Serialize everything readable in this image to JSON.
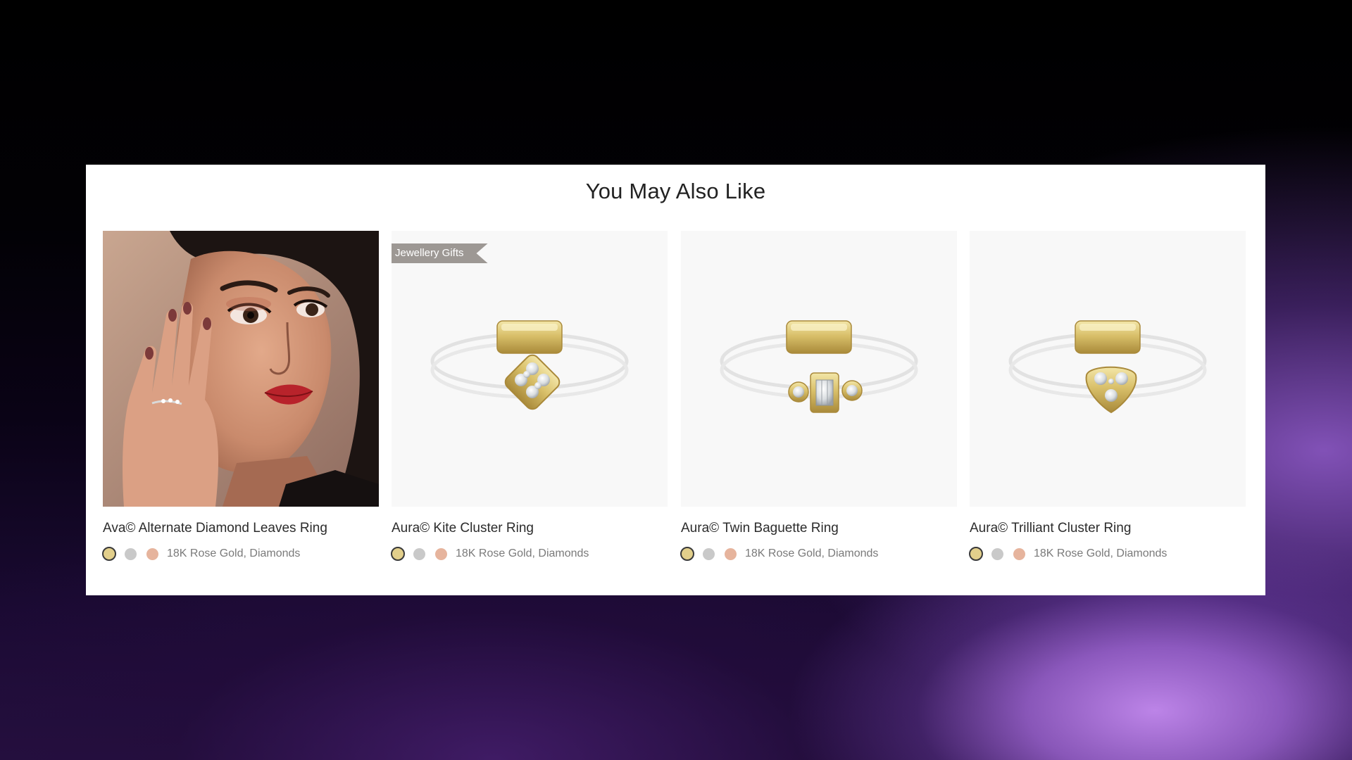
{
  "section": {
    "title": "You May Also Like"
  },
  "swatch_colors": {
    "yellow_gold": "#e2cf8b",
    "white_gold": "#c9c9c9",
    "rose_gold": "#e6b49d"
  },
  "products": [
    {
      "name": "Ava© Alternate Diamond Leaves Ring",
      "material": "18K Rose Gold, Diamonds",
      "badge": "",
      "image": "model-wearing-ring-photo",
      "selected_swatch": "yellow_gold"
    },
    {
      "name": "Aura© Kite Cluster Ring",
      "material": "18K Rose Gold, Diamonds",
      "badge": "Jewellery Gifts",
      "image": "kite-cluster-ring-photo",
      "selected_swatch": "yellow_gold"
    },
    {
      "name": "Aura© Twin Baguette Ring",
      "material": "18K Rose Gold, Diamonds",
      "badge": "",
      "image": "twin-baguette-ring-photo",
      "selected_swatch": "yellow_gold"
    },
    {
      "name": "Aura© Trilliant Cluster Ring",
      "material": "18K Rose Gold, Diamonds",
      "badge": "",
      "image": "trilliant-cluster-ring-photo",
      "selected_swatch": "yellow_gold"
    }
  ]
}
